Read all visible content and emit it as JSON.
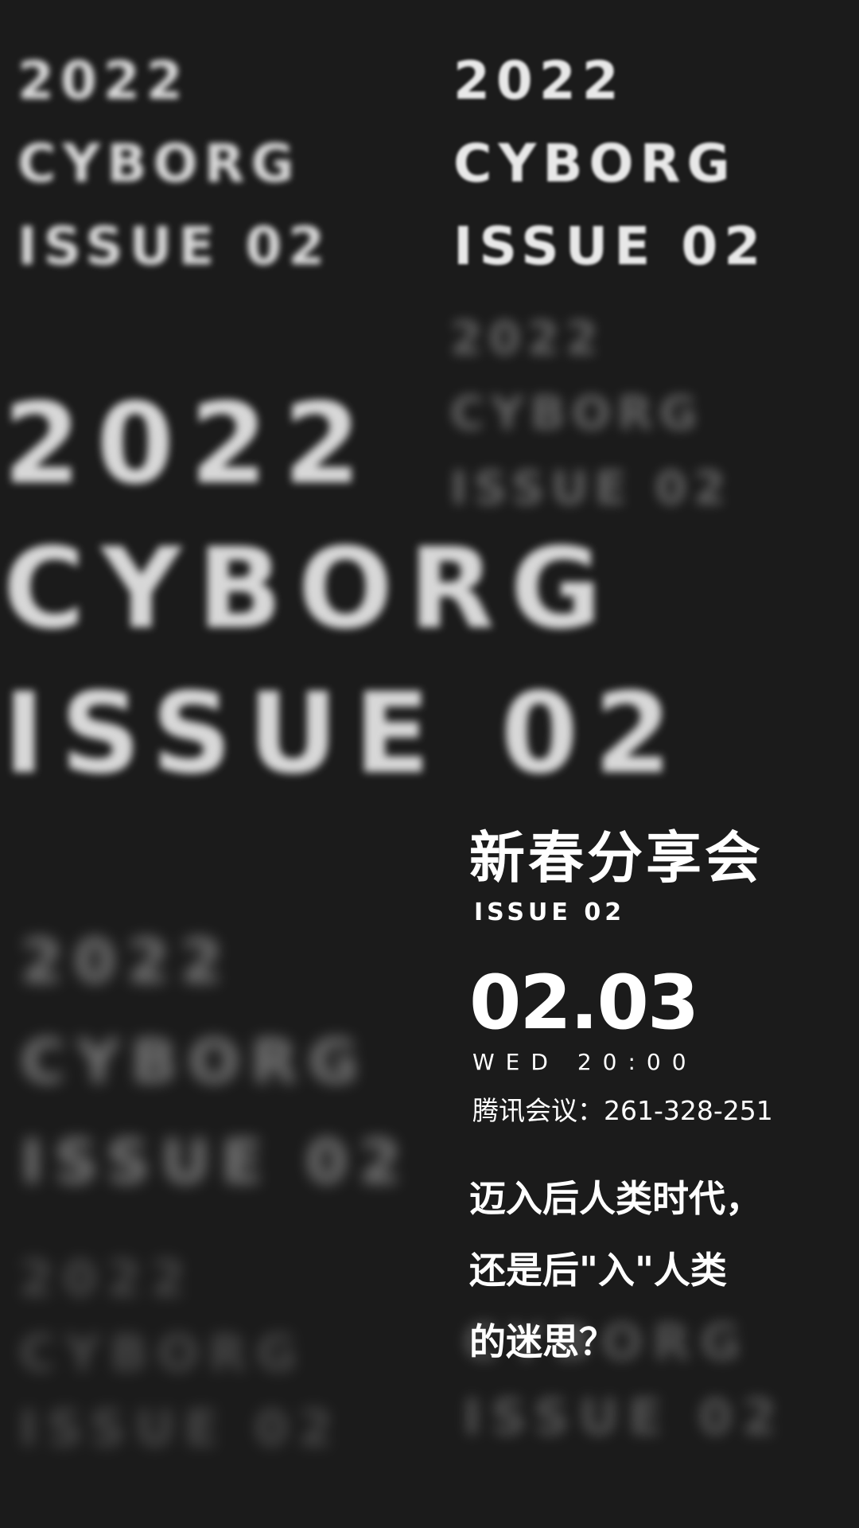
{
  "background": {
    "color": "#1b1b1b",
    "text_blocks": [
      {
        "lines": [
          "2022",
          "CYBORG",
          "ISSUE 02"
        ]
      },
      {
        "lines": [
          "2022",
          "CYBORG",
          "ISSUE 02"
        ]
      },
      {
        "lines": [
          "2022",
          "CYBORG",
          "ISSUE 02"
        ]
      },
      {
        "lines": [
          "2022",
          "CYBORG",
          "ISSUE 02"
        ]
      },
      {
        "lines": [
          "2022",
          "CYBORG",
          "ISSUE 02"
        ]
      },
      {
        "lines": [
          "2022",
          "CYBORG",
          "ISSUE 02"
        ]
      },
      {
        "lines": [
          "CYBORG",
          "ISSUE 02"
        ]
      }
    ]
  },
  "event": {
    "title": "新春分享会",
    "issue": "ISSUE 02",
    "date": "02.03",
    "time": "WED 20:00",
    "meeting": "腾讯会议：261-328-251",
    "tagline": [
      "迈入后人类时代，",
      "还是后\"入\"人类",
      "的迷思？"
    ]
  }
}
